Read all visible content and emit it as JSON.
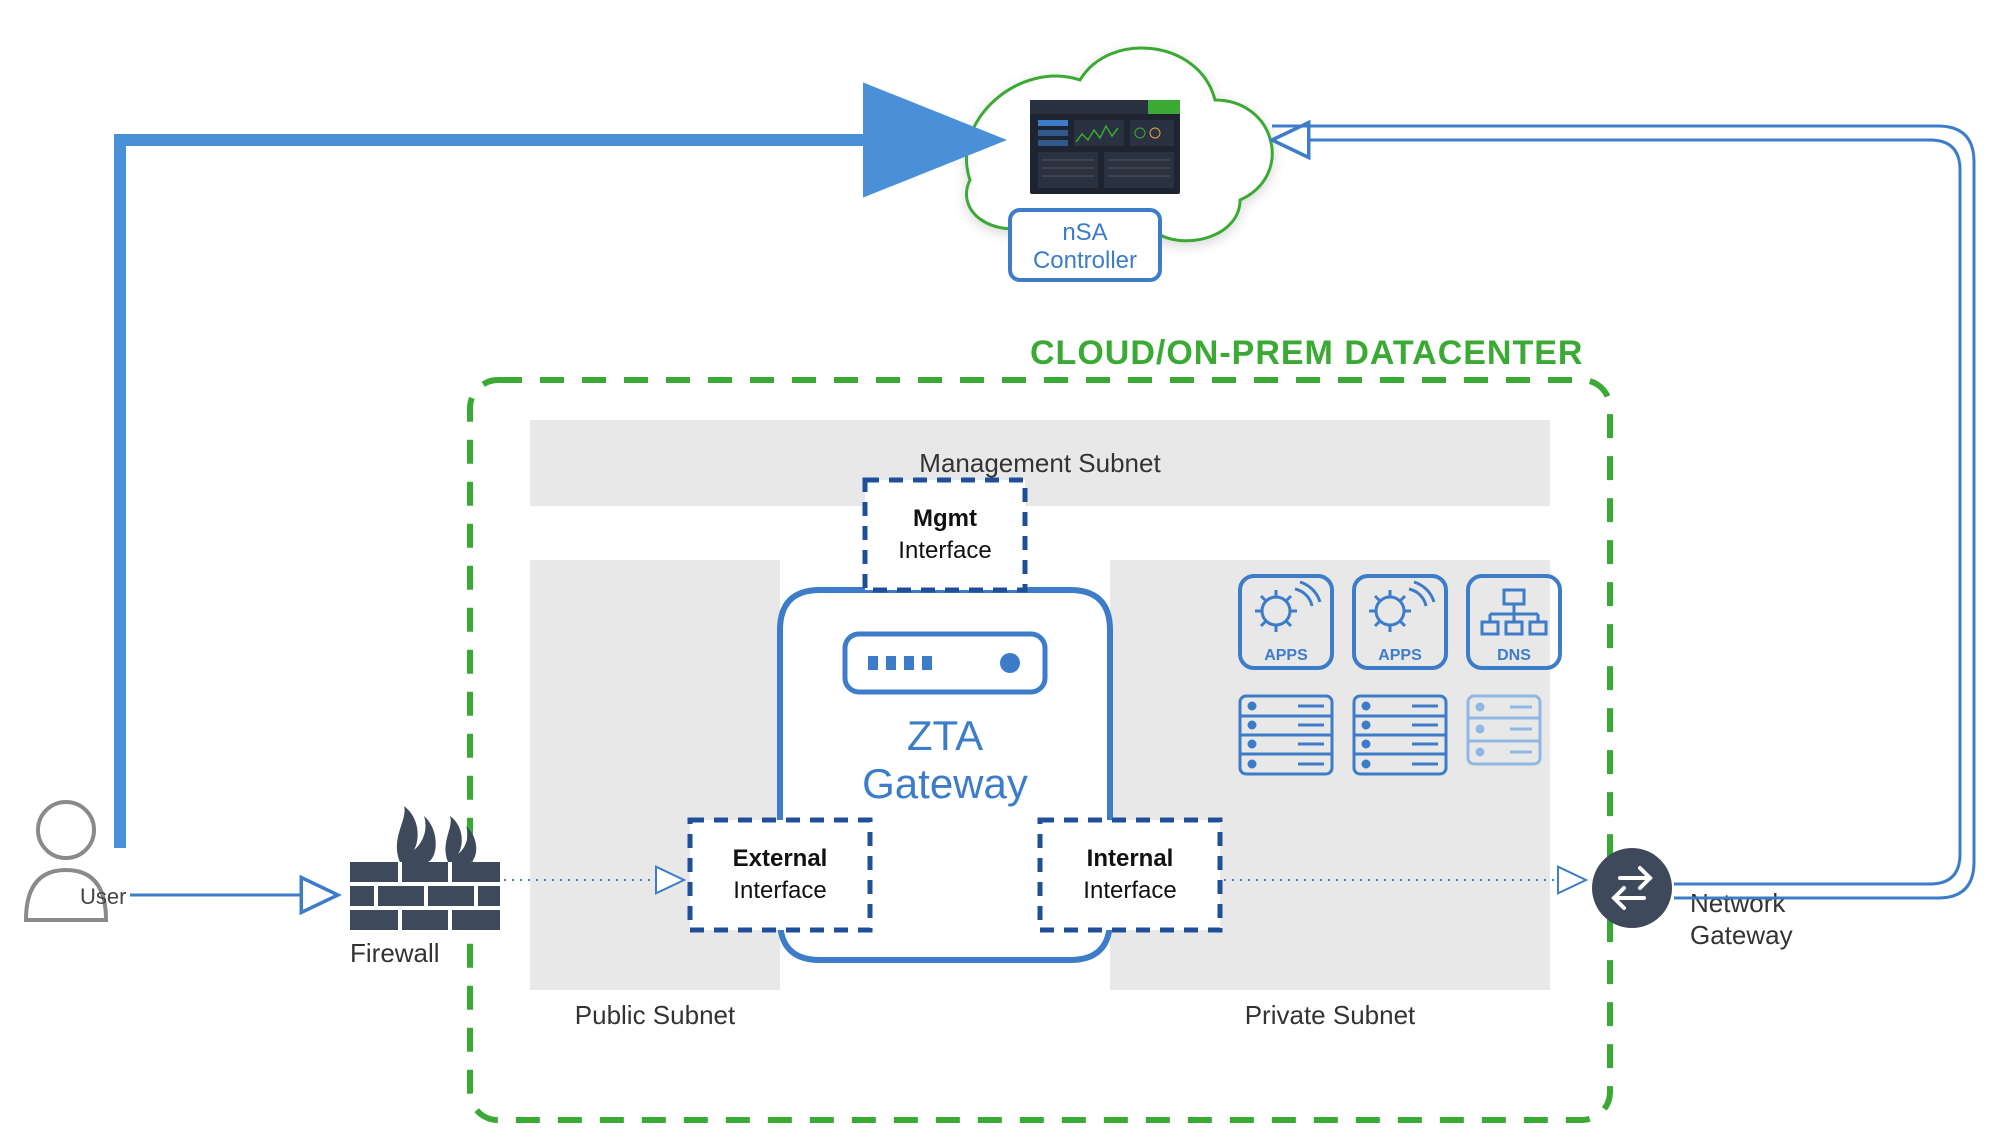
{
  "title_datacenter": "CLOUD/ON-PREM DATACENTER",
  "user": {
    "label": "User"
  },
  "firewall": {
    "label": "Firewall"
  },
  "network_gateway": {
    "label_line1": "Network",
    "label_line2": "Gateway"
  },
  "subnets": {
    "management": "Management Subnet",
    "public": "Public Subnet",
    "private": "Private Subnet"
  },
  "zta_gateway": {
    "title_line1": "ZTA",
    "title_line2": "Gateway",
    "interfaces": {
      "external_bold": "External",
      "external_plain": "Interface",
      "internal_bold": "Internal",
      "internal_plain": "Interface",
      "mgmt_bold": "Mgmt",
      "mgmt_plain": "Interface"
    }
  },
  "controller": {
    "label_line1": "nSA",
    "label_line2": "Controller"
  },
  "private_services": {
    "apps1": "APPS",
    "apps2": "APPS",
    "dns": "DNS"
  },
  "colors": {
    "green": "#3aaa35",
    "blue": "#3d7cc9",
    "blue_fill": "#4a90d9",
    "dark_blue": "#1f4e9b",
    "grey_box": "#e8e8e8",
    "grey_stroke": "#8a8a8a",
    "slate": "#3e4a5b",
    "light_blue": "#8fb8e6"
  }
}
